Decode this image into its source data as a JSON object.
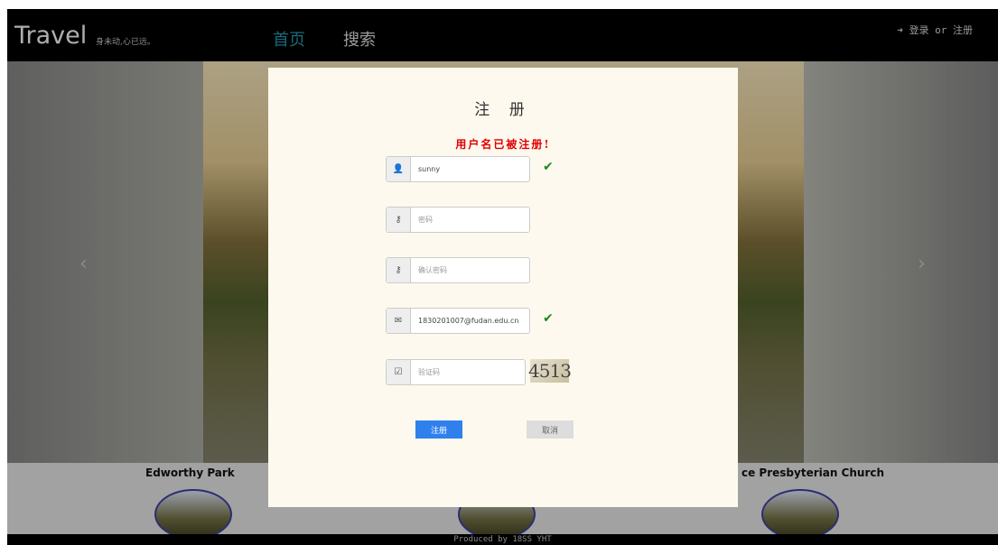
{
  "navbar": {
    "brand": "Travel",
    "slogan": "身未动,心已远。",
    "links": [
      "首页",
      "搜索"
    ],
    "auth": {
      "login": "登录",
      "or": "or",
      "register": "注册"
    }
  },
  "carousel": {
    "prev_icon": "chevron-left-icon",
    "next_icon": "chevron-right-icon"
  },
  "thumbnails": [
    "Edworthy Park",
    "",
    "ce Presbyterian Church"
  ],
  "footer": "Produced by 18SS YHT",
  "modal": {
    "title": "注 册",
    "error": "用户名已被注册!",
    "username": {
      "value": "sunny",
      "icon": "user-icon"
    },
    "password": {
      "placeholder": "密码",
      "icon": "key-icon"
    },
    "confirm_password": {
      "placeholder": "确认密码",
      "icon": "key-icon"
    },
    "email": {
      "value": "1830201007@fudan.edu.cn",
      "icon": "envelope-icon"
    },
    "captcha": {
      "placeholder": "验证码",
      "image_text": "4513",
      "icon": "checkbox-icon"
    },
    "submit_label": "注册",
    "cancel_label": "取消"
  },
  "colors": {
    "navbar_bg": "#000000",
    "home_link": "#1e8fa6",
    "error": "#e00000",
    "primary": "#2f80ed",
    "check": "#1a8a1a"
  }
}
